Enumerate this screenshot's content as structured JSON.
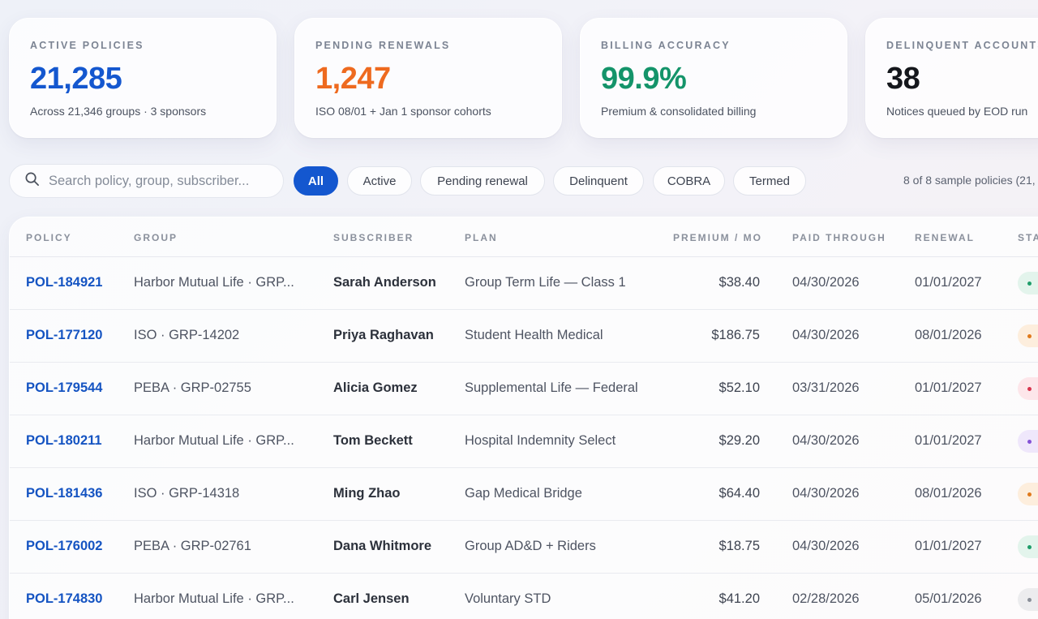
{
  "kpis": [
    {
      "label": "ACTIVE POLICIES",
      "value": "21,285",
      "note": "Across 21,346 groups · 3 sponsors",
      "color": "#1457cf"
    },
    {
      "label": "PENDING RENEWALS",
      "value": "1,247",
      "note": "ISO 08/01 + Jan 1 sponsor cohorts",
      "color": "#ee6a1f"
    },
    {
      "label": "BILLING ACCURACY",
      "value": "99.9%",
      "note": "Premium & consolidated billing",
      "color": "#14946a"
    },
    {
      "label": "DELINQUENT ACCOUNTS",
      "value": "38",
      "note": "Notices queued by EOD run",
      "color": "#15171c"
    }
  ],
  "search": {
    "placeholder": "Search policy, group, subscriber..."
  },
  "filters": [
    "All",
    "Active",
    "Pending renewal",
    "Delinquent",
    "COBRA",
    "Termed"
  ],
  "active_filter": "All",
  "count_text": "8 of 8 sample policies (21,",
  "table": {
    "headers": [
      "POLICY",
      "GROUP",
      "SUBSCRIBER",
      "PLAN",
      "PREMIUM / MO",
      "PAID THROUGH",
      "RENEWAL",
      "STA"
    ],
    "rows": [
      {
        "policy": "POL-184921",
        "group": "Harbor Mutual Life · GRP...",
        "subscriber": "Sarah Anderson",
        "plan": "Group Term Life — Class 1",
        "premium": "$38.40",
        "paid_through": "04/30/2026",
        "renewal": "01/01/2027",
        "status_color": "#e3f4ec",
        "dot_color": "#1f9d6a"
      },
      {
        "policy": "POL-177120",
        "group": "ISO · GRP-14202",
        "subscriber": "Priya Raghavan",
        "plan": "Student Health Medical",
        "premium": "$186.75",
        "paid_through": "04/30/2026",
        "renewal": "08/01/2026",
        "status_color": "#fdeedd",
        "dot_color": "#e07a1c"
      },
      {
        "policy": "POL-179544",
        "group": "PEBA · GRP-02755",
        "subscriber": "Alicia Gomez",
        "plan": "Supplemental Life — Federal",
        "premium": "$52.10",
        "paid_through": "03/31/2026",
        "renewal": "01/01/2027",
        "status_color": "#fde6ea",
        "dot_color": "#d8354f"
      },
      {
        "policy": "POL-180211",
        "group": "Harbor Mutual Life · GRP...",
        "subscriber": "Tom Beckett",
        "plan": "Hospital Indemnity Select",
        "premium": "$29.20",
        "paid_through": "04/30/2026",
        "renewal": "01/01/2027",
        "status_color": "#efe7fb",
        "dot_color": "#8452d6"
      },
      {
        "policy": "POL-181436",
        "group": "ISO · GRP-14318",
        "subscriber": "Ming Zhao",
        "plan": "Gap Medical Bridge",
        "premium": "$64.40",
        "paid_through": "04/30/2026",
        "renewal": "08/01/2026",
        "status_color": "#fdeedd",
        "dot_color": "#e07a1c"
      },
      {
        "policy": "POL-176002",
        "group": "PEBA · GRP-02761",
        "subscriber": "Dana Whitmore",
        "plan": "Group AD&D + Riders",
        "premium": "$18.75",
        "paid_through": "04/30/2026",
        "renewal": "01/01/2027",
        "status_color": "#e3f4ec",
        "dot_color": "#1f9d6a"
      },
      {
        "policy": "POL-174830",
        "group": "Harbor Mutual Life · GRP...",
        "subscriber": "Carl Jensen",
        "plan": "Voluntary STD",
        "premium": "$41.20",
        "paid_through": "02/28/2026",
        "renewal": "05/01/2026",
        "status_color": "#ececee",
        "dot_color": "#8a8f99"
      }
    ]
  }
}
